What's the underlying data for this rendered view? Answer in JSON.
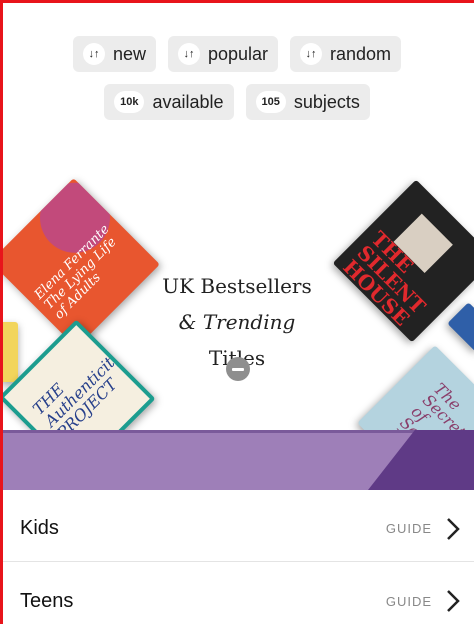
{
  "sort_chips": [
    {
      "label": "new",
      "icon": "sort-arrows-icon"
    },
    {
      "label": "popular",
      "icon": "sort-arrows-icon"
    },
    {
      "label": "random",
      "icon": "sort-arrows-icon"
    }
  ],
  "stats": [
    {
      "count": "10k",
      "label": "available"
    },
    {
      "count": "105",
      "label": "subjects"
    }
  ],
  "hero": {
    "title_line1": "UK Bestsellers",
    "title_line2": "& Trending",
    "title_line3": "Titles",
    "collapse_icon": "minus-circle-icon",
    "covers": [
      {
        "text": "Elena Ferrante The Lying Life of Adults"
      },
      {
        "text": "THE Authenticity PROJECT"
      },
      {
        "text": "THE SILENT HOUSE"
      },
      {
        "text": "The Secrets of Saffron Hall"
      }
    ]
  },
  "colors": {
    "band_light": "#9e7fb8",
    "band_dark": "#5f3a86",
    "frame": "#e8141b"
  },
  "categories": [
    {
      "label": "Kids",
      "action": "GUIDE",
      "icon": "chevron-right-icon"
    },
    {
      "label": "Teens",
      "action": "GUIDE",
      "icon": "chevron-right-icon"
    }
  ]
}
